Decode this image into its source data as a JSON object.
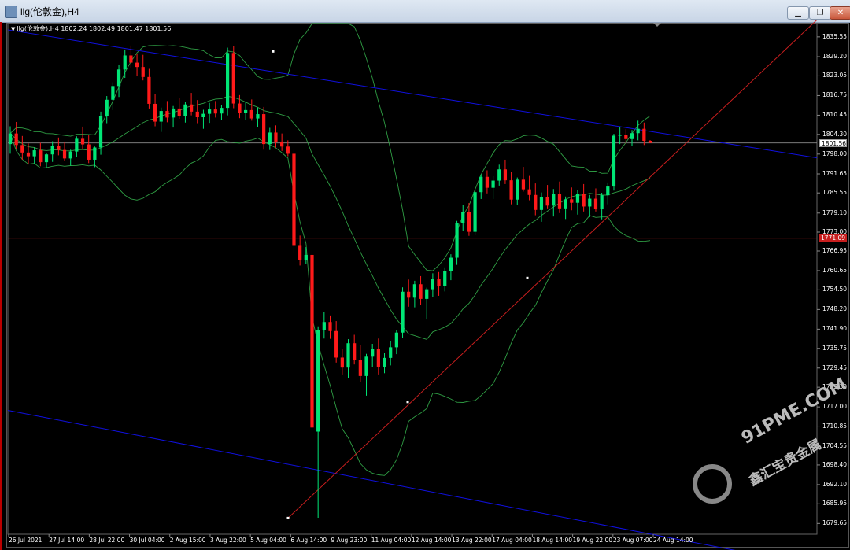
{
  "window": {
    "title": "llg(伦敦金),H4",
    "buttons": {
      "minimize": "▁",
      "restore": "❐",
      "close": "✕"
    }
  },
  "legend": {
    "symbol_icon": "triangle-down-icon",
    "text": "llg(伦敦金),H4  1802.24 1802.49 1801.47 1801.56"
  },
  "colors": {
    "bull": "#00e676",
    "bear": "#ff1a1a",
    "bands": "#2f9e44",
    "channel": "#1010e0",
    "trendline": "#c81e1e",
    "hline_current": "#8c8c8c",
    "hline_red": "#c81e1e"
  },
  "watermark": {
    "text": "91PME.COM",
    "sub": "鑫汇宝贵金属"
  },
  "price_boxes": {
    "current": "1801.56",
    "red_line": "1771.09"
  },
  "chart_data": {
    "type": "candlestick",
    "title": "llg(伦敦金),H4",
    "ohlc_current": {
      "open": 1802.24,
      "high": 1802.49,
      "low": 1801.47,
      "close": 1801.56
    },
    "ylim": [
      1676.2,
      1839.8
    ],
    "price_ticks": [
      "1835.55",
      "1829.20",
      "1823.05",
      "1816.75",
      "1810.45",
      "1804.30",
      "1798.00",
      "1791.65",
      "1785.55",
      "1779.10",
      "1773.00",
      "1766.95",
      "1760.65",
      "1754.50",
      "1748.20",
      "1741.90",
      "1735.75",
      "1729.45",
      "1723.30",
      "1717.00",
      "1710.85",
      "1704.55",
      "1698.40",
      "1692.10",
      "1685.95",
      "1679.65"
    ],
    "time_labels": [
      "26 Jul 2021",
      "27 Jul 14:00",
      "28 Jul 22:00",
      "30 Jul 04:00",
      "2 Aug 15:00",
      "3 Aug 22:00",
      "5 Aug 04:00",
      "6 Aug 14:00",
      "9 Aug 23:00",
      "11 Aug 04:00",
      "12 Aug 14:00",
      "13 Aug 22:00",
      "17 Aug 04:00",
      "18 Aug 14:00",
      "19 Aug 22:00",
      "23 Aug 07:00",
      "24 Aug 14:00"
    ],
    "candles": [
      [
        1801.2,
        1806.9,
        1798.1,
        1804.6
      ],
      [
        1804.6,
        1808.3,
        1799.5,
        1800.9
      ],
      [
        1800.9,
        1803.8,
        1796.2,
        1798.5
      ],
      [
        1798.5,
        1801.4,
        1794.9,
        1797.3
      ],
      [
        1797.3,
        1800.1,
        1795.0,
        1799.2
      ],
      [
        1799.2,
        1801.6,
        1794.1,
        1795.4
      ],
      [
        1795.4,
        1798.2,
        1793.7,
        1797.9
      ],
      [
        1797.9,
        1802.1,
        1795.5,
        1800.7
      ],
      [
        1800.7,
        1803.3,
        1797.6,
        1799.3
      ],
      [
        1799.3,
        1801.9,
        1795.8,
        1796.6
      ],
      [
        1796.6,
        1799.4,
        1794.3,
        1798.8
      ],
      [
        1798.8,
        1803.7,
        1797.1,
        1802.9
      ],
      [
        1802.9,
        1806.8,
        1799.4,
        1801.1
      ],
      [
        1801.1,
        1804.0,
        1795.1,
        1796.2
      ],
      [
        1796.2,
        1800.4,
        1793.8,
        1800.1
      ],
      [
        1800.1,
        1811.6,
        1797.8,
        1810.2
      ],
      [
        1810.2,
        1816.6,
        1807.9,
        1815.4
      ],
      [
        1815.4,
        1821.0,
        1812.1,
        1819.8
      ],
      [
        1819.8,
        1826.7,
        1816.3,
        1825.1
      ],
      [
        1825.1,
        1831.5,
        1822.4,
        1829.6
      ],
      [
        1829.6,
        1832.8,
        1825.7,
        1827.3
      ],
      [
        1827.3,
        1830.1,
        1822.9,
        1825.9
      ],
      [
        1825.9,
        1829.8,
        1821.6,
        1822.7
      ],
      [
        1822.7,
        1825.3,
        1812.6,
        1814.1
      ],
      [
        1814.1,
        1817.2,
        1806.9,
        1808.4
      ],
      [
        1808.4,
        1812.9,
        1805.1,
        1811.8
      ],
      [
        1811.8,
        1815.0,
        1808.2,
        1809.7
      ],
      [
        1809.7,
        1813.4,
        1806.5,
        1812.6
      ],
      [
        1812.6,
        1816.1,
        1809.3,
        1810.2
      ],
      [
        1810.2,
        1814.7,
        1808.1,
        1813.9
      ],
      [
        1813.9,
        1817.6,
        1810.4,
        1811.6
      ],
      [
        1811.6,
        1815.3,
        1807.9,
        1809.8
      ],
      [
        1809.8,
        1812.2,
        1806.1,
        1810.9
      ],
      [
        1810.9,
        1814.4,
        1808.0,
        1812.3
      ],
      [
        1812.3,
        1815.0,
        1809.7,
        1811.0
      ],
      [
        1811.0,
        1813.6,
        1808.8,
        1812.8
      ],
      [
        1812.8,
        1832.1,
        1810.4,
        1830.4
      ],
      [
        1830.4,
        1832.6,
        1812.7,
        1814.2
      ],
      [
        1814.2,
        1816.9,
        1809.5,
        1811.3
      ],
      [
        1811.3,
        1814.6,
        1808.8,
        1812.1
      ],
      [
        1812.1,
        1815.5,
        1808.7,
        1809.4
      ],
      [
        1809.4,
        1812.9,
        1806.6,
        1810.8
      ],
      [
        1810.8,
        1813.1,
        1799.4,
        1801.2
      ],
      [
        1801.2,
        1806.4,
        1799.3,
        1804.9
      ],
      [
        1804.9,
        1807.2,
        1800.1,
        1802.0
      ],
      [
        1802.0,
        1804.6,
        1799.0,
        1800.4
      ],
      [
        1800.4,
        1802.4,
        1797.3,
        1798.1
      ],
      [
        1798.1,
        1799.7,
        1766.4,
        1768.6
      ],
      [
        1768.6,
        1771.9,
        1762.3,
        1764.1
      ],
      [
        1764.1,
        1768.2,
        1762.8,
        1765.7
      ],
      [
        1765.7,
        1767.0,
        1709.1,
        1710.4
      ],
      [
        1709.1,
        1742.8,
        1681.5,
        1741.6
      ],
      [
        1741.6,
        1747.4,
        1738.9,
        1744.2
      ],
      [
        1744.2,
        1746.3,
        1738.8,
        1741.3
      ],
      [
        1741.3,
        1744.5,
        1731.2,
        1732.8
      ],
      [
        1732.8,
        1735.6,
        1727.4,
        1729.6
      ],
      [
        1729.6,
        1738.7,
        1726.3,
        1737.4
      ],
      [
        1737.4,
        1740.1,
        1730.6,
        1732.1
      ],
      [
        1732.1,
        1736.8,
        1725.0,
        1726.9
      ],
      [
        1726.9,
        1734.0,
        1720.6,
        1733.1
      ],
      [
        1733.1,
        1737.2,
        1729.8,
        1735.5
      ],
      [
        1735.5,
        1738.9,
        1727.4,
        1729.9
      ],
      [
        1729.9,
        1734.3,
        1727.8,
        1732.7
      ],
      [
        1732.7,
        1738.0,
        1730.3,
        1736.1
      ],
      [
        1736.1,
        1741.6,
        1733.9,
        1740.8
      ],
      [
        1740.8,
        1755.3,
        1739.2,
        1753.9
      ],
      [
        1753.9,
        1757.8,
        1749.1,
        1752.0
      ],
      [
        1752.0,
        1757.4,
        1748.9,
        1756.3
      ],
      [
        1756.3,
        1758.9,
        1749.7,
        1751.6
      ],
      [
        1751.6,
        1755.2,
        1745.0,
        1754.7
      ],
      [
        1754.7,
        1759.8,
        1752.3,
        1758.1
      ],
      [
        1758.1,
        1760.2,
        1752.6,
        1755.8
      ],
      [
        1755.8,
        1761.7,
        1754.0,
        1760.4
      ],
      [
        1760.4,
        1765.9,
        1757.6,
        1764.8
      ],
      [
        1764.8,
        1776.6,
        1762.5,
        1775.9
      ],
      [
        1775.9,
        1781.7,
        1773.4,
        1779.4
      ],
      [
        1779.4,
        1782.3,
        1771.8,
        1773.1
      ],
      [
        1773.1,
        1786.4,
        1772.0,
        1785.8
      ],
      [
        1785.8,
        1791.5,
        1783.6,
        1790.7
      ],
      [
        1790.7,
        1792.8,
        1785.4,
        1787.2
      ],
      [
        1787.2,
        1790.9,
        1783.6,
        1789.5
      ],
      [
        1789.5,
        1794.6,
        1787.9,
        1793.1
      ],
      [
        1793.1,
        1796.2,
        1788.4,
        1789.6
      ],
      [
        1789.6,
        1792.3,
        1781.9,
        1783.4
      ],
      [
        1783.4,
        1790.5,
        1781.6,
        1789.8
      ],
      [
        1789.8,
        1793.9,
        1786.0,
        1786.7
      ],
      [
        1786.7,
        1791.0,
        1783.2,
        1784.9
      ],
      [
        1784.9,
        1788.6,
        1778.4,
        1780.1
      ],
      [
        1780.1,
        1785.7,
        1776.3,
        1784.2
      ],
      [
        1784.2,
        1788.1,
        1780.6,
        1781.5
      ],
      [
        1781.5,
        1786.8,
        1778.0,
        1785.3
      ],
      [
        1785.3,
        1789.2,
        1779.1,
        1780.6
      ],
      [
        1780.6,
        1784.4,
        1777.2,
        1783.5
      ],
      [
        1783.5,
        1787.3,
        1780.0,
        1782.4
      ],
      [
        1782.4,
        1786.6,
        1778.6,
        1785.1
      ],
      [
        1785.1,
        1788.4,
        1779.6,
        1781.2
      ],
      [
        1781.2,
        1784.9,
        1777.8,
        1783.7
      ],
      [
        1783.7,
        1787.0,
        1779.6,
        1780.3
      ],
      [
        1780.3,
        1785.6,
        1777.1,
        1784.8
      ],
      [
        1784.8,
        1788.9,
        1781.9,
        1787.6
      ],
      [
        1787.6,
        1804.5,
        1786.3,
        1803.9
      ],
      [
        1803.9,
        1806.8,
        1801.2,
        1804.1
      ],
      [
        1804.1,
        1806.0,
        1801.3,
        1802.8
      ],
      [
        1802.8,
        1805.7,
        1800.6,
        1804.7
      ],
      [
        1804.7,
        1808.7,
        1802.4,
        1806.1
      ],
      [
        1806.1,
        1808.1,
        1800.9,
        1802.24
      ],
      [
        1802.24,
        1802.49,
        1801.47,
        1801.56
      ]
    ],
    "indicators": [
      "Bollinger Bands"
    ],
    "horizontal_lines": [
      1801.56,
      1771.09
    ],
    "trendlines": [
      {
        "name": "upper channel",
        "from": [
          "start",
          1837.8
        ],
        "to": [
          "end",
          1796.8
        ]
      },
      {
        "name": "lower channel",
        "from": [
          "start",
          1715.9
        ],
        "to": [
          "end",
          1666.0
        ]
      },
      {
        "name": "rising trend",
        "from": [
          "6 Aug 14:00",
          1681.4
        ],
        "to": [
          "end",
          1841.0
        ]
      }
    ]
  }
}
